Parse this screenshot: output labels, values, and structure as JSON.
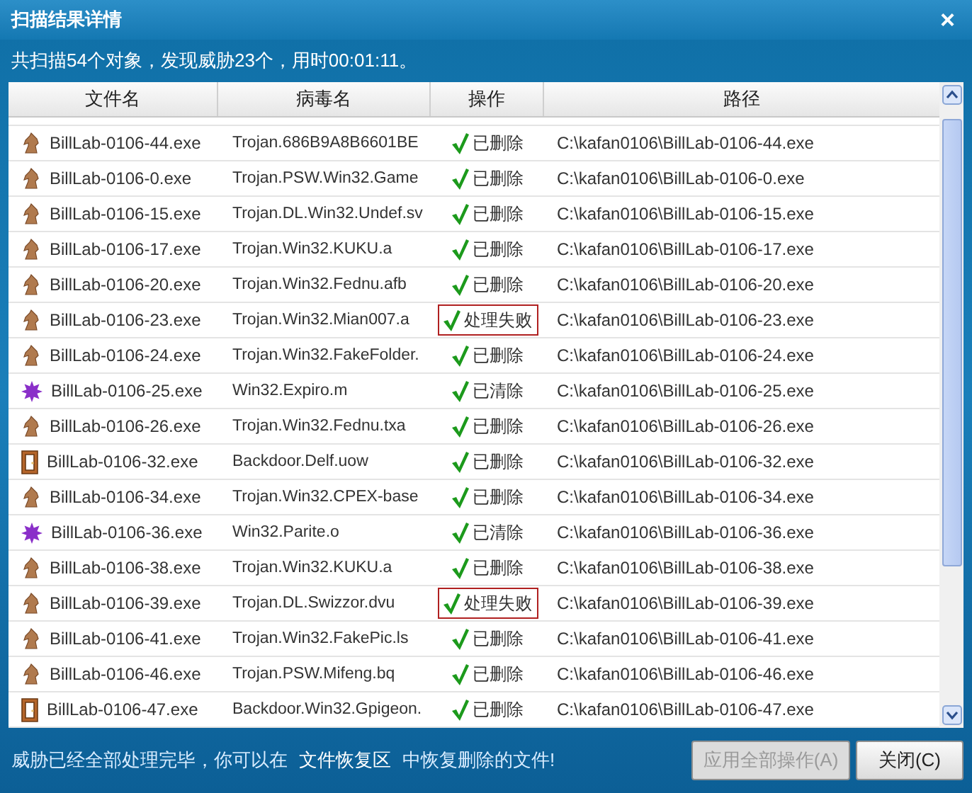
{
  "window": {
    "title": "扫描结果详情",
    "close": "×"
  },
  "summary": "共扫描54个对象，发现威胁23个，用时00:01:11。",
  "table": {
    "columns": [
      "文件名",
      "病毒名",
      "操作",
      "路径"
    ],
    "rows": [
      {
        "kind": "trojan",
        "file": "BillLab-0106-44.exe",
        "virus": "Trojan.686B9A8B6601BE",
        "action": "已删除",
        "failed": false,
        "path": "C:\\kafan0106\\BillLab-0106-44.exe"
      },
      {
        "kind": "trojan",
        "file": "BillLab-0106-0.exe",
        "virus": "Trojan.PSW.Win32.Game",
        "action": "已删除",
        "failed": false,
        "path": "C:\\kafan0106\\BillLab-0106-0.exe"
      },
      {
        "kind": "trojan",
        "file": "BillLab-0106-15.exe",
        "virus": "Trojan.DL.Win32.Undef.sv",
        "action": "已删除",
        "failed": false,
        "path": "C:\\kafan0106\\BillLab-0106-15.exe"
      },
      {
        "kind": "trojan",
        "file": "BillLab-0106-17.exe",
        "virus": "Trojan.Win32.KUKU.a",
        "action": "已删除",
        "failed": false,
        "path": "C:\\kafan0106\\BillLab-0106-17.exe"
      },
      {
        "kind": "trojan",
        "file": "BillLab-0106-20.exe",
        "virus": "Trojan.Win32.Fednu.afb",
        "action": "已删除",
        "failed": false,
        "path": "C:\\kafan0106\\BillLab-0106-20.exe"
      },
      {
        "kind": "trojan",
        "file": "BillLab-0106-23.exe",
        "virus": "Trojan.Win32.Mian007.a",
        "action": "处理失败",
        "failed": true,
        "path": "C:\\kafan0106\\BillLab-0106-23.exe"
      },
      {
        "kind": "trojan",
        "file": "BillLab-0106-24.exe",
        "virus": "Trojan.Win32.FakeFolder.",
        "action": "已删除",
        "failed": false,
        "path": "C:\\kafan0106\\BillLab-0106-24.exe"
      },
      {
        "kind": "virus",
        "file": "BillLab-0106-25.exe",
        "virus": "Win32.Expiro.m",
        "action": "已清除",
        "failed": false,
        "path": "C:\\kafan0106\\BillLab-0106-25.exe"
      },
      {
        "kind": "trojan",
        "file": "BillLab-0106-26.exe",
        "virus": "Trojan.Win32.Fednu.txa",
        "action": "已删除",
        "failed": false,
        "path": "C:\\kafan0106\\BillLab-0106-26.exe"
      },
      {
        "kind": "backdoor",
        "file": "BillLab-0106-32.exe",
        "virus": "Backdoor.Delf.uow",
        "action": "已删除",
        "failed": false,
        "path": "C:\\kafan0106\\BillLab-0106-32.exe"
      },
      {
        "kind": "trojan",
        "file": "BillLab-0106-34.exe",
        "virus": "Trojan.Win32.CPEX-base",
        "action": "已删除",
        "failed": false,
        "path": "C:\\kafan0106\\BillLab-0106-34.exe"
      },
      {
        "kind": "virus",
        "file": "BillLab-0106-36.exe",
        "virus": "Win32.Parite.o",
        "action": "已清除",
        "failed": false,
        "path": "C:\\kafan0106\\BillLab-0106-36.exe"
      },
      {
        "kind": "trojan",
        "file": "BillLab-0106-38.exe",
        "virus": "Trojan.Win32.KUKU.a",
        "action": "已删除",
        "failed": false,
        "path": "C:\\kafan0106\\BillLab-0106-38.exe"
      },
      {
        "kind": "trojan",
        "file": "BillLab-0106-39.exe",
        "virus": "Trojan.DL.Swizzor.dvu",
        "action": "处理失败",
        "failed": true,
        "path": "C:\\kafan0106\\BillLab-0106-39.exe"
      },
      {
        "kind": "trojan",
        "file": "BillLab-0106-41.exe",
        "virus": "Trojan.Win32.FakePic.ls",
        "action": "已删除",
        "failed": false,
        "path": "C:\\kafan0106\\BillLab-0106-41.exe"
      },
      {
        "kind": "trojan",
        "file": "BillLab-0106-46.exe",
        "virus": "Trojan.PSW.Mifeng.bq",
        "action": "已删除",
        "failed": false,
        "path": "C:\\kafan0106\\BillLab-0106-46.exe"
      },
      {
        "kind": "backdoor",
        "file": "BillLab-0106-47.exe",
        "virus": "Backdoor.Win32.Gpigeon.",
        "action": "已删除",
        "failed": false,
        "path": "C:\\kafan0106\\BillLab-0106-47.exe"
      }
    ]
  },
  "footer": {
    "before": "威胁已经全部处理完毕，你可以在",
    "link": "文件恢复区",
    "after": "中恢复删除的文件!"
  },
  "buttons": [
    {
      "label": "应用全部操作(A)",
      "disabled": true
    },
    {
      "label": "关闭(C)",
      "disabled": false
    }
  ]
}
